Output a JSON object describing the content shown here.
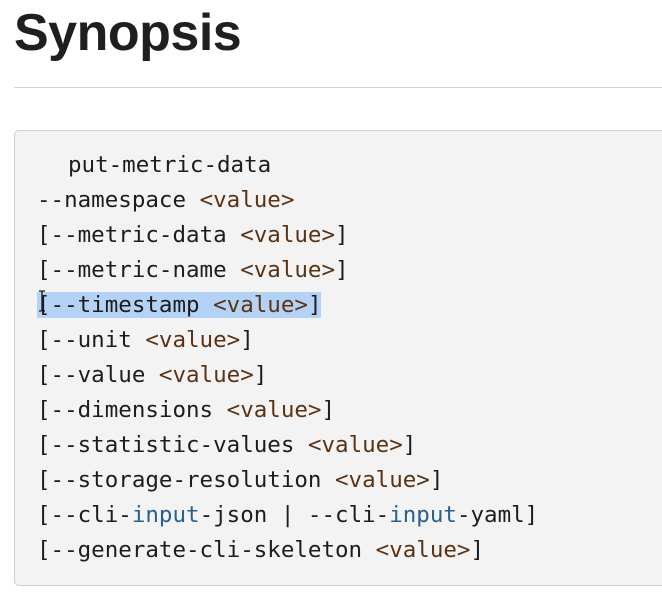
{
  "page": {
    "title": "Synopsis"
  },
  "synopsis": {
    "command": "put-metric-data",
    "lines": [
      {
        "pre": "--namespace ",
        "placeholder": "<value>",
        "post": ""
      },
      {
        "pre": "[--metric-data ",
        "placeholder": "<value>",
        "post": "]"
      },
      {
        "pre": "[--metric-name ",
        "placeholder": "<value>",
        "post": "]"
      },
      {
        "pre": "[--timestamp ",
        "placeholder": "<value>",
        "post": "]"
      },
      {
        "pre": "[--unit ",
        "placeholder": "<value>",
        "post": "]"
      },
      {
        "pre": "[--value ",
        "placeholder": "<value>",
        "post": "]"
      },
      {
        "pre": "[--dimensions ",
        "placeholder": "<value>",
        "post": "]"
      },
      {
        "pre": "[--statistic-values ",
        "placeholder": "<value>",
        "post": "]"
      },
      {
        "pre": "[--storage-resolution ",
        "placeholder": "<value>",
        "post": "]"
      },
      {
        "pre": "[--generate-cli-skeleton ",
        "placeholder": "<value>",
        "post": "]"
      }
    ],
    "cli_input_line": {
      "part1": "[--cli-",
      "kw1": "input",
      "part2": "-json | --cli-",
      "kw2": "input",
      "part3": "-yaml]"
    }
  },
  "colors": {
    "selection": "#b4d2f5",
    "keyword": "#2a5f8f",
    "placeholder": "#5a3314"
  },
  "icons": {
    "text_cursor": "i-beam-cursor-icon"
  }
}
